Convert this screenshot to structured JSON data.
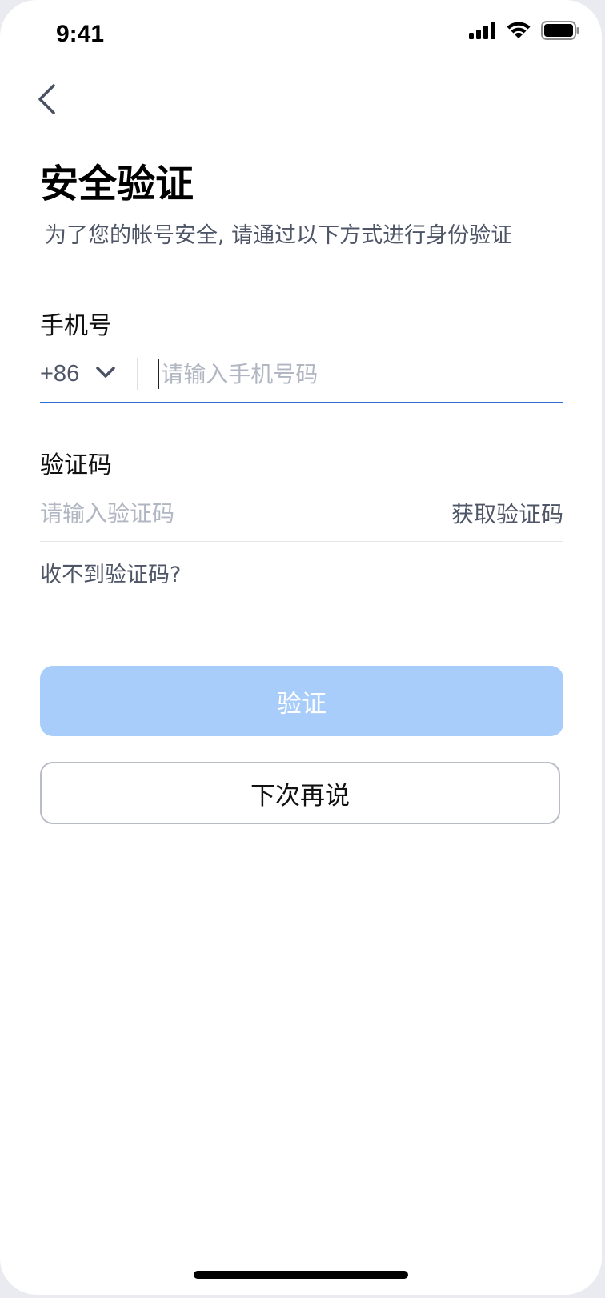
{
  "status_bar": {
    "time": "9:41",
    "icons": [
      "signal-icon",
      "wifi-icon",
      "battery-icon"
    ]
  },
  "header": {
    "back_icon": "chevron-left-icon",
    "title": "安全验证",
    "subtitle": "为了您的帐号安全, 请通过以下方式进行身份验证"
  },
  "phone_field": {
    "label": "手机号",
    "country_code": "+86",
    "placeholder": "请输入手机号码",
    "value": ""
  },
  "code_field": {
    "label": "验证码",
    "placeholder": "请输入验证码",
    "value": "",
    "get_code_label": "获取验证码"
  },
  "no_code_link": "收不到验证码?",
  "buttons": {
    "verify_label": "验证",
    "later_label": "下次再说"
  },
  "colors": {
    "accent": "#2f6fd6",
    "verify_disabled_bg": "#a8cdfb",
    "muted_text": "#4d5566",
    "placeholder": "#b0b6c2"
  }
}
